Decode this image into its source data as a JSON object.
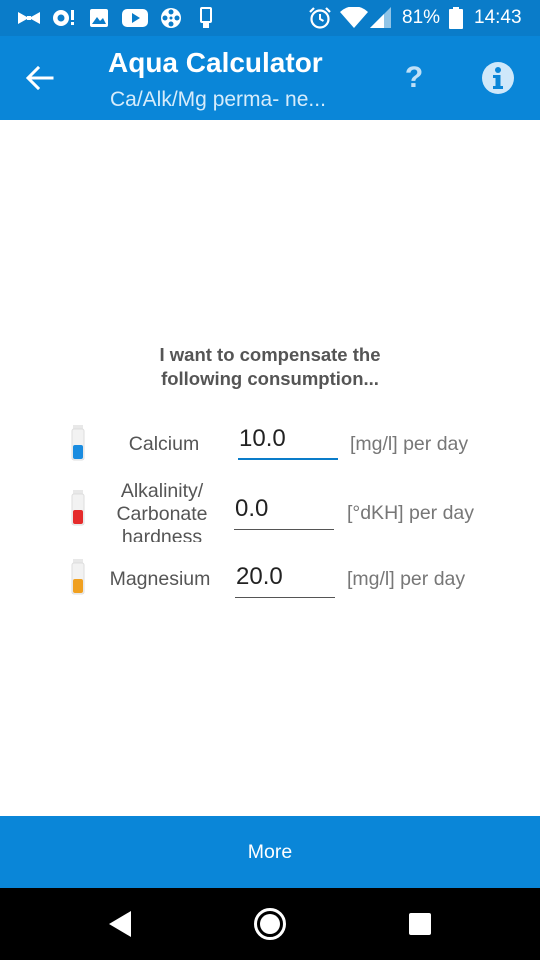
{
  "status_bar": {
    "battery_percent": "81%",
    "time": "14:43",
    "notification_icons": [
      "bowtie-icon",
      "exclamation-badge-icon",
      "image-icon",
      "youtube-icon",
      "film-reel-icon",
      "usb-device-icon"
    ],
    "system_icons": [
      "alarm-icon",
      "wifi-icon",
      "cell-signal-icon",
      "battery-icon"
    ]
  },
  "toolbar": {
    "title": "Aqua Calculator",
    "subtitle": "Ca/Alk/Mg perma- ne...",
    "help_glyph": "?",
    "colors": {
      "background": "#0a86d8",
      "status": "#0a7cc9"
    }
  },
  "main": {
    "heading_line1": "I want to compensate the",
    "heading_line2": "following consumption...",
    "rows": [
      {
        "label_line1": "Calcium",
        "value": "10.0",
        "unit": "[mg/l] per day",
        "vial_color": "#1a8ce0"
      },
      {
        "label_line1": "Alkalinity/",
        "label_line2": "Carbonate",
        "label_line3": "hardness",
        "value": "0.0",
        "unit": "[°dKH] per day",
        "vial_color": "#e52b2b"
      },
      {
        "label_line1": "Magnesium",
        "value": "20.0",
        "unit": "[mg/l] per day",
        "vial_color": "#f0a020"
      }
    ]
  },
  "footer": {
    "more_label": "More"
  }
}
